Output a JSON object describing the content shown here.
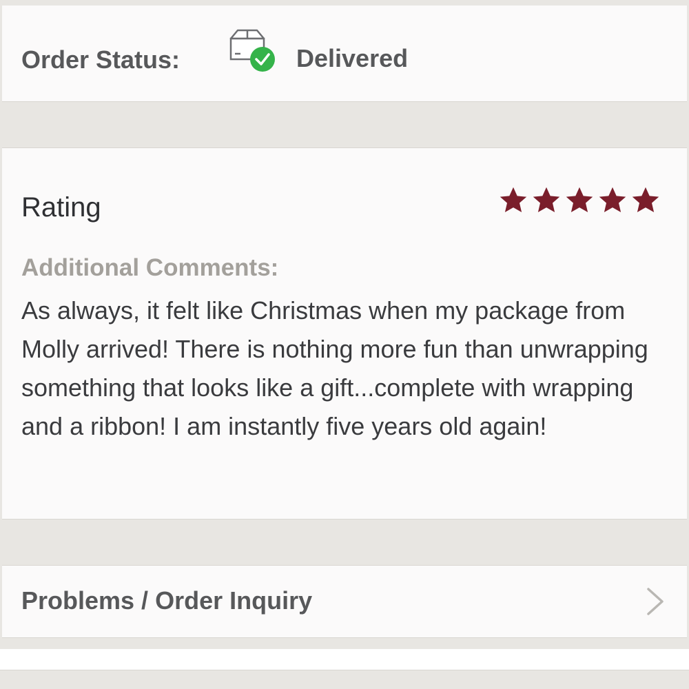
{
  "order_status": {
    "label": "Order Status:",
    "value": "Delivered",
    "icon": "delivered-box-check-icon"
  },
  "rating": {
    "title": "Rating",
    "stars": 5,
    "max_stars": 5,
    "star_color": "#7a1e2b"
  },
  "comments": {
    "label": "Additional Comments:",
    "text": "As always, it felt like Christmas when my package from Molly arrived! There is nothing more fun than unwrapping something that looks like a gift...complete with wrapping and a ribbon! I am instantly five years old again!"
  },
  "problems": {
    "label": "Problems / Order Inquiry",
    "icon": "chevron-right-icon"
  },
  "colors": {
    "check_green": "#35b34a",
    "background": "#e8e6e2"
  }
}
